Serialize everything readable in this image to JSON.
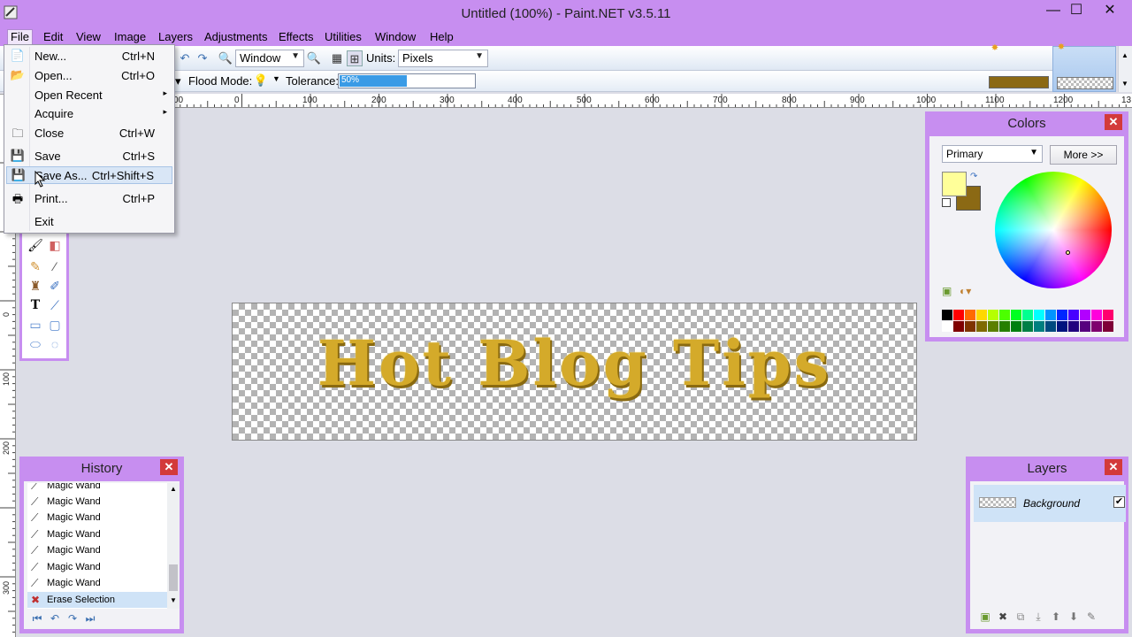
{
  "window": {
    "title": "Untitled (100%) - Paint.NET v3.5.11",
    "minimize": "—",
    "maximize": "☐",
    "close": "✕"
  },
  "menubar": {
    "items": [
      "File",
      "Edit",
      "View",
      "Image",
      "Layers",
      "Adjustments",
      "Effects",
      "Utilities",
      "Window",
      "Help"
    ]
  },
  "toolbar": {
    "zoom_select": "Window",
    "units_label": "Units:",
    "units_select": "Pixels",
    "flood_mode_label": "Flood Mode:",
    "tolerance_label": "Tolerance:",
    "tolerance_value": "50%",
    "tolerance_fraction": 0.5
  },
  "file_menu": {
    "items": [
      {
        "label": "New...",
        "shortcut": "Ctrl+N",
        "icon": "new-icon"
      },
      {
        "label": "Open...",
        "shortcut": "Ctrl+O",
        "icon": "open-icon"
      },
      {
        "label": "Open Recent",
        "shortcut": "",
        "submenu": "▸"
      },
      {
        "label": "Acquire",
        "shortcut": "",
        "submenu": "▸"
      },
      {
        "label": "Close",
        "shortcut": "Ctrl+W",
        "icon": "close-doc-icon"
      },
      {
        "label": "Save",
        "shortcut": "Ctrl+S",
        "icon": "save-icon"
      },
      {
        "label": "Save As...",
        "shortcut": "Ctrl+Shift+S",
        "icon": "save-as-icon",
        "highlighted": true
      },
      {
        "label": "Print...",
        "shortcut": "Ctrl+P",
        "icon": "print-icon"
      },
      {
        "label": "Exit",
        "shortcut": ""
      }
    ]
  },
  "ruler": {
    "top_labels": [
      "00",
      "0",
      "100",
      "200",
      "300",
      "400",
      "500",
      "600",
      "700",
      "800",
      "900",
      "1000",
      "1100",
      "1200",
      "13"
    ],
    "left_labels": [
      "0",
      "100",
      "200",
      "300"
    ]
  },
  "canvas": {
    "text": "Hot Blog Tips"
  },
  "colors_panel": {
    "title": "Colors",
    "select_value": "Primary",
    "more_button": "More >>",
    "primary_color": "#ffff99",
    "secondary_color": "#8b6914",
    "palette": [
      "#000000",
      "#ff0000",
      "#ff6a00",
      "#ffd800",
      "#b6ff00",
      "#4cff00",
      "#00ff21",
      "#00ff90",
      "#00ffff",
      "#0094ff",
      "#0026ff",
      "#4800ff",
      "#b200ff",
      "#ff00dc",
      "#ff006e"
    ],
    "palette_dark": [
      "#ffffff",
      "#7f0000",
      "#7f3300",
      "#7f6a00",
      "#5b7f00",
      "#267f00",
      "#007f0e",
      "#007f46",
      "#007f7f",
      "#004a7f",
      "#00137f",
      "#21007f",
      "#57007f",
      "#7f006e",
      "#7f0037"
    ]
  },
  "history_panel": {
    "title": "History",
    "items": [
      "Magic Wand",
      "Magic Wand",
      "Magic Wand",
      "Magic Wand",
      "Magic Wand",
      "Magic Wand",
      "Magic Wand",
      "Erase Selection"
    ]
  },
  "layers_panel": {
    "title": "Layers",
    "layers": [
      {
        "name": "Background",
        "visible": true
      }
    ]
  },
  "icons": {
    "close_panel": "✕",
    "checkbox_checked": "✔"
  }
}
